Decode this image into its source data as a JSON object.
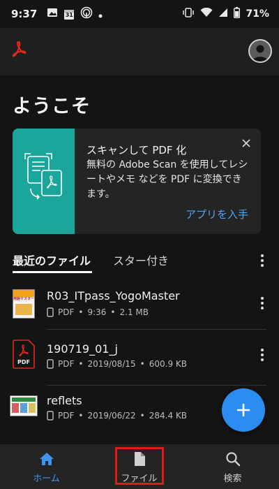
{
  "status_bar": {
    "time": "9:37",
    "calendar_day": "31",
    "battery": "71%",
    "icons": [
      "image-icon",
      "calendar-icon",
      "nfc-icon",
      "dot-icon",
      "vibrate-icon",
      "wifi-icon",
      "signal-icon",
      "battery-icon"
    ]
  },
  "header": {
    "logo": "acrobat-logo-icon",
    "avatar": "profile-avatar-icon"
  },
  "welcome": "ようこそ",
  "promo": {
    "title": "スキャンして PDF 化",
    "body": "無料の Adobe Scan を使用してレシートやメモ などを PDF に変換できます。",
    "cta": "アプリを入手",
    "accent_color": "#1aa69a"
  },
  "tabs": {
    "recent": "最近のファイル",
    "starred": "スター付き"
  },
  "files": [
    {
      "name": "R03_ITpass_YogoMaster",
      "type": "PDF",
      "date": "9:36",
      "size": "2.1 MB",
      "thumb_text": "用語マスター"
    },
    {
      "name": "190719_01_j",
      "type": "PDF",
      "date": "2019/08/15",
      "size": "600.9 KB",
      "thumb_text": "PDF"
    },
    {
      "name": "reflets",
      "type": "PDF",
      "date": "2019/06/22",
      "size": "284.4 KB",
      "thumb_text": ""
    }
  ],
  "meta_separator": "•",
  "bottom_nav": {
    "home": "ホーム",
    "files": "ファイル",
    "search": "検索"
  },
  "colors": {
    "brand_red": "#e3281b",
    "link_blue": "#4fa3f7",
    "fab_blue": "#2c8cef",
    "nav_active": "#3e95f0",
    "highlight": "#e11a1a"
  }
}
